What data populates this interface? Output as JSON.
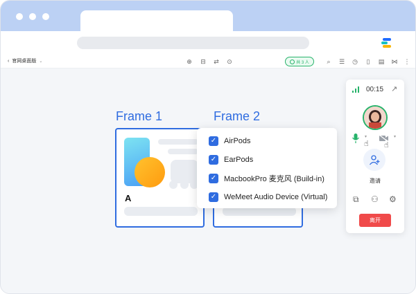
{
  "breadcrumb": {
    "title": "官网桌面版"
  },
  "collab": {
    "label": "共 3 人"
  },
  "frames": [
    {
      "title": "Frame 1",
      "card_label": "A"
    },
    {
      "title": "Frame 2"
    }
  ],
  "audio_devices": [
    {
      "label": "AirPods",
      "checked": true
    },
    {
      "label": "EarPods",
      "checked": true
    },
    {
      "label": "MacbookPro 麦克风 (Build-in)",
      "checked": true
    },
    {
      "label": "WeMeet Audio Device (Virtual)",
      "checked": true
    }
  ],
  "call_panel": {
    "timer": "00:15",
    "invite_label": "邀请",
    "leave_label": "离开"
  },
  "colors": {
    "accent": "#2f6ce0",
    "success": "#27b36b",
    "danger": "#f04a4a",
    "titlebar": "#bcd1f4"
  }
}
